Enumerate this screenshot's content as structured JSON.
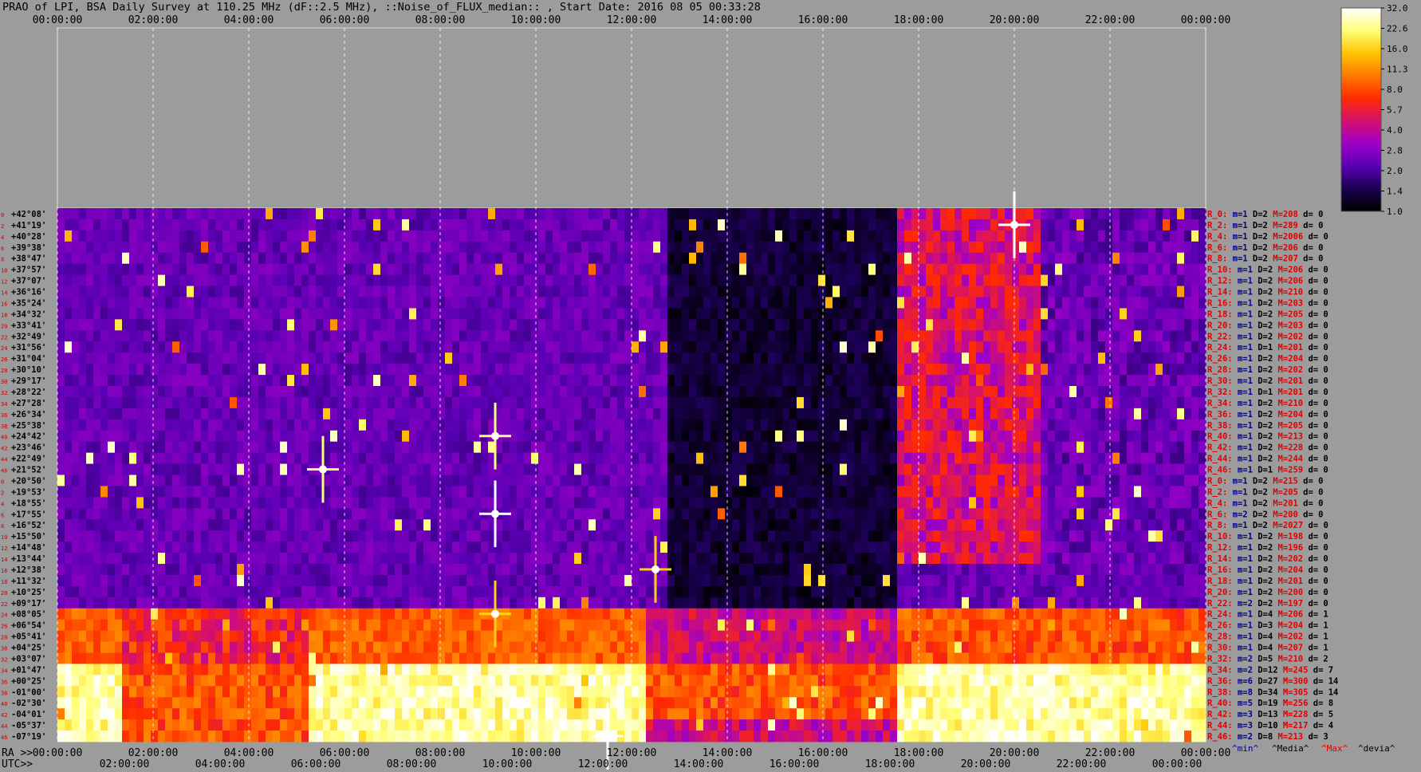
{
  "title": "PRAO of LPI, BSA Daily Survey at 110.25 MHz (dF::2.5 MHz), ::Noise_of_FLUX_median:: , Start Date: 2016 08 05 00:33:28",
  "chart_data": {
    "type": "heatmap",
    "title": "PRAO of LPI, BSA Daily Survey at 110.25 MHz (dF::2.5 MHz), ::Noise_of_FLUX_median:: , Start Date: 2016 08 05 00:33:28",
    "top_axis_ticks": [
      "00:00:00",
      "02:00:00",
      "04:00:00",
      "06:00:00",
      "08:00:00",
      "10:00:00",
      "12:00:00",
      "14:00:00",
      "16:00:00",
      "18:00:00",
      "20:00:00",
      "22:00:00",
      "00:00:00"
    ],
    "ra_prefix": "RA >>",
    "ra_axis_ticks": [
      "00:00:00",
      "02:00:00",
      "04:00:00",
      "06:00:00",
      "08:00:00",
      "10:00:00",
      "12:00:00",
      "14:00:00",
      "16:00:00",
      "18:00:00",
      "20:00:00",
      "22:00:00",
      "00:00:00"
    ],
    "utc_prefix": "UTC>>",
    "utc_axis_ticks": [
      "02:00:00",
      "04:00:00",
      "06:00:00",
      "08:00:00",
      "10:00:00",
      "12:00:00",
      "14:00:00",
      "16:00:00",
      "18:00:00",
      "20:00:00",
      "22:00:00",
      "00:00:00"
    ],
    "declinations": [
      "+42°08'",
      "+41°19'",
      "+40°28'",
      "+39°38'",
      "+38°47'",
      "+37°57'",
      "+37°07'",
      "+36°16'",
      "+35°24'",
      "+34°32'",
      "+33°41'",
      "+32°49'",
      "+31°56'",
      "+31°04'",
      "+30°10'",
      "+29°17'",
      "+28°22'",
      "+27°28'",
      "+26°34'",
      "+25°38'",
      "+24°42'",
      "+23°46'",
      "+22°49'",
      "+21°52'",
      "+20°50'",
      "+19°53'",
      "+18°55'",
      "+17°55'",
      "+16°52'",
      "+15°50'",
      "+14°48'",
      "+13°44'",
      "+12°38'",
      "+11°32'",
      "+10°25'",
      "+09°17'",
      "+08°05'",
      "+06°54'",
      "+05°41'",
      "+04°25'",
      "+03°07'",
      "+01°47'",
      "+00°25'",
      "-01°00'",
      "-02°30'",
      "-04°01'",
      "-05°37'",
      "-07°19'"
    ],
    "beam_numbers": [
      "0",
      "2",
      "4",
      "6",
      "8",
      "10",
      "12",
      "14",
      "16",
      "18",
      "20",
      "22",
      "24",
      "26",
      "28",
      "30",
      "32",
      "34",
      "36",
      "38",
      "40",
      "42",
      "44",
      "46",
      "0",
      "2",
      "4",
      "6",
      "8",
      "10",
      "12",
      "14",
      "16",
      "18",
      "20",
      "22",
      "24",
      "26",
      "28",
      "30",
      "32",
      "34",
      "36",
      "38",
      "40",
      "42",
      "44",
      "46"
    ],
    "right_stats": [
      {
        "r": "R_0:",
        "m": "m=1",
        "d": "D=2",
        "M": "M=208",
        "dv": "d= 0"
      },
      {
        "r": "R_2:",
        "m": "m=1",
        "d": "D=2",
        "M": "M=289",
        "dv": "d= 0"
      },
      {
        "r": "R_4:",
        "m": "m=1",
        "d": "D=2",
        "M": "M=2006",
        "dv": "d= 0"
      },
      {
        "r": "R_6:",
        "m": "m=1",
        "d": "D=2",
        "M": "M=206",
        "dv": "d= 0"
      },
      {
        "r": "R_8:",
        "m": "m=1",
        "d": "D=2",
        "M": "M=207",
        "dv": "d= 0"
      },
      {
        "r": "R_10:",
        "m": "m=1",
        "d": "D=2",
        "M": "M=206",
        "dv": "d= 0"
      },
      {
        "r": "R_12:",
        "m": "m=1",
        "d": "D=2",
        "M": "M=206",
        "dv": "d= 0"
      },
      {
        "r": "R_14:",
        "m": "m=1",
        "d": "D=2",
        "M": "M=210",
        "dv": "d= 0"
      },
      {
        "r": "R_16:",
        "m": "m=1",
        "d": "D=2",
        "M": "M=203",
        "dv": "d= 0"
      },
      {
        "r": "R_18:",
        "m": "m=1",
        "d": "D=2",
        "M": "M=205",
        "dv": "d= 0"
      },
      {
        "r": "R_20:",
        "m": "m=1",
        "d": "D=2",
        "M": "M=203",
        "dv": "d= 0"
      },
      {
        "r": "R_22:",
        "m": "m=1",
        "d": "D=2",
        "M": "M=202",
        "dv": "d= 0"
      },
      {
        "r": "R_24:",
        "m": "m=1",
        "d": "D=1",
        "M": "M=201",
        "dv": "d= 0"
      },
      {
        "r": "R_26:",
        "m": "m=1",
        "d": "D=2",
        "M": "M=204",
        "dv": "d= 0"
      },
      {
        "r": "R_28:",
        "m": "m=1",
        "d": "D=2",
        "M": "M=202",
        "dv": "d= 0"
      },
      {
        "r": "R_30:",
        "m": "m=1",
        "d": "D=2",
        "M": "M=201",
        "dv": "d= 0"
      },
      {
        "r": "R_32:",
        "m": "m=1",
        "d": "D=1",
        "M": "M=201",
        "dv": "d= 0"
      },
      {
        "r": "R_34:",
        "m": "m=1",
        "d": "D=2",
        "M": "M=210",
        "dv": "d= 0"
      },
      {
        "r": "R_36:",
        "m": "m=1",
        "d": "D=2",
        "M": "M=204",
        "dv": "d= 0"
      },
      {
        "r": "R_38:",
        "m": "m=1",
        "d": "D=2",
        "M": "M=205",
        "dv": "d= 0"
      },
      {
        "r": "R_40:",
        "m": "m=1",
        "d": "D=2",
        "M": "M=213",
        "dv": "d= 0"
      },
      {
        "r": "R_42:",
        "m": "m=1",
        "d": "D=2",
        "M": "M=228",
        "dv": "d= 0"
      },
      {
        "r": "R_44:",
        "m": "m=1",
        "d": "D=2",
        "M": "M=244",
        "dv": "d= 0"
      },
      {
        "r": "R_46:",
        "m": "m=1",
        "d": "D=1",
        "M": "M=259",
        "dv": "d= 0"
      },
      {
        "r": "R_0:",
        "m": "m=1",
        "d": "D=2",
        "M": "M=215",
        "dv": "d= 0"
      },
      {
        "r": "R_2:",
        "m": "m=1",
        "d": "D=2",
        "M": "M=205",
        "dv": "d= 0"
      },
      {
        "r": "R_4:",
        "m": "m=1",
        "d": "D=2",
        "M": "M=201",
        "dv": "d= 0"
      },
      {
        "r": "R_6:",
        "m": "m=2",
        "d": "D=2",
        "M": "M=200",
        "dv": "d= 0"
      },
      {
        "r": "R_8:",
        "m": "m=1",
        "d": "D=2",
        "M": "M=2027",
        "dv": "d= 0"
      },
      {
        "r": "R_10:",
        "m": "m=1",
        "d": "D=2",
        "M": "M=198",
        "dv": "d= 0"
      },
      {
        "r": "R_12:",
        "m": "m=1",
        "d": "D=2",
        "M": "M=196",
        "dv": "d= 0"
      },
      {
        "r": "R_14:",
        "m": "m=1",
        "d": "D=2",
        "M": "M=202",
        "dv": "d= 0"
      },
      {
        "r": "R_16:",
        "m": "m=1",
        "d": "D=2",
        "M": "M=204",
        "dv": "d= 0"
      },
      {
        "r": "R_18:",
        "m": "m=1",
        "d": "D=2",
        "M": "M=201",
        "dv": "d= 0"
      },
      {
        "r": "R_20:",
        "m": "m=1",
        "d": "D=2",
        "M": "M=200",
        "dv": "d= 0"
      },
      {
        "r": "R_22:",
        "m": "m=2",
        "d": "D=2",
        "M": "M=197",
        "dv": "d= 0"
      },
      {
        "r": "R_24:",
        "m": "m=1",
        "d": "D=4",
        "M": "M=206",
        "dv": "d= 1"
      },
      {
        "r": "R_26:",
        "m": "m=1",
        "d": "D=3",
        "M": "M=204",
        "dv": "d= 1"
      },
      {
        "r": "R_28:",
        "m": "m=1",
        "d": "D=4",
        "M": "M=202",
        "dv": "d= 1"
      },
      {
        "r": "R_30:",
        "m": "m=1",
        "d": "D=4",
        "M": "M=207",
        "dv": "d= 1"
      },
      {
        "r": "R_32:",
        "m": "m=2",
        "d": "D=5",
        "M": "M=210",
        "dv": "d= 2"
      },
      {
        "r": "R_34:",
        "m": "m=2",
        "d": "D=12",
        "M": "M=245",
        "dv": "d= 7"
      },
      {
        "r": "R_36:",
        "m": "m=6",
        "d": "D=27",
        "M": "M=300",
        "dv": "d= 14"
      },
      {
        "r": "R_38:",
        "m": "m=8",
        "d": "D=34",
        "M": "M=305",
        "dv": "d= 14"
      },
      {
        "r": "R_40:",
        "m": "m=5",
        "d": "D=19",
        "M": "M=256",
        "dv": "d= 8"
      },
      {
        "r": "R_42:",
        "m": "m=3",
        "d": "D=13",
        "M": "M=228",
        "dv": "d= 5"
      },
      {
        "r": "R_44:",
        "m": "m=3",
        "d": "D=10",
        "M": "M=217",
        "dv": "d= 4"
      },
      {
        "r": "R_46:",
        "m": "m=2",
        "d": "D=8",
        "M": "M=213",
        "dv": "d= 3"
      }
    ],
    "stat_legend": [
      "^min^",
      "^Media^",
      "^Max^",
      "^devia^"
    ],
    "colorbar_ticks": [
      "32.0",
      "22.6",
      "16.0",
      "11.3",
      "8.0",
      "5.7",
      "4.0",
      "2.8",
      "2.0",
      "1.4",
      "1.0"
    ],
    "colorscale": [
      "#000000",
      "#1a0050",
      "#5a00b4",
      "#9e00c8",
      "#d4106e",
      "#ff2a00",
      "#ff7800",
      "#ffc400",
      "#ffff78",
      "#ffffff"
    ],
    "colors": {
      "background": "#9c9c9c",
      "grid": "#ffffff",
      "labels": "#000000",
      "row_numbers": "#c80000",
      "stat_min": "#00008c",
      "stat_max": "#e00000"
    },
    "structure": {
      "quiet_zone_ra_hours": [
        12.8,
        17.5
      ],
      "bright_bands_ra_hours": [
        [
          0.0,
          1.3
        ],
        [
          5.3,
          12.3
        ],
        [
          17.6,
          24.0
        ]
      ],
      "bright_band_declination_range": [
        "+01°47'",
        "-07°19'"
      ],
      "point_sources": [
        {
          "ra_hours": 9.15,
          "dec": "+17°55'",
          "level": 32
        },
        {
          "ra_hours": 20.0,
          "dec": "+41°19'",
          "level": 32
        },
        {
          "ra_hours": 9.15,
          "dec": "+24°42'",
          "level": 22
        },
        {
          "ra_hours": 5.55,
          "dec": "+21°52'",
          "level": 22
        },
        {
          "ra_hours": 12.5,
          "dec": "+12°38'",
          "level": 16
        },
        {
          "ra_hours": 9.15,
          "dec": "+08°05'",
          "level": 16
        },
        {
          "ra_hours": 11.5,
          "dec": "-07°19'",
          "level": 32
        }
      ]
    }
  }
}
